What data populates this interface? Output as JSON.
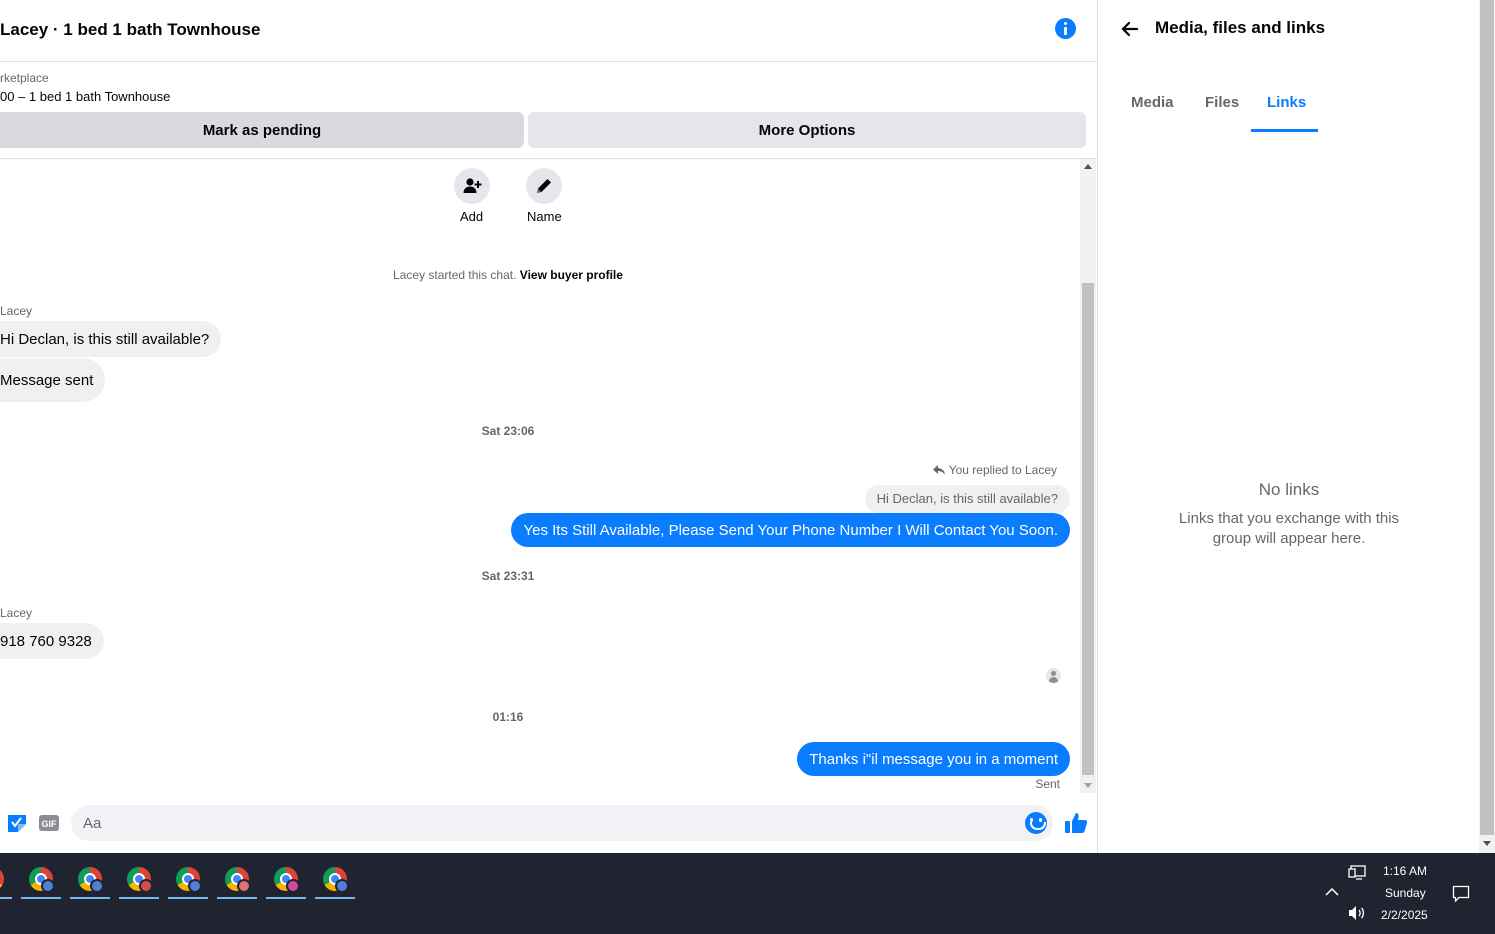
{
  "chat": {
    "title": "Lacey · 1 bed 1 bath Townhouse",
    "marketplace_label": "rketplace",
    "listing": "00 – 1 bed 1 bath Townhouse",
    "mark_pending_label": "Mark as pending",
    "more_options_label": "More Options",
    "actions": [
      {
        "label": "Add",
        "icon": "add-person-icon"
      },
      {
        "label": "Name",
        "icon": "pencil-icon"
      }
    ],
    "system_line": {
      "text": "Lacey started this chat.",
      "link": "View buyer profile"
    },
    "sender_name": "Lacey",
    "messages_in_1": [
      "Hi Declan, is this still available?",
      "Message sent"
    ],
    "timestamp_1": "Sat 23:06",
    "reply_label": "You replied to Lacey",
    "quoted_text": "Hi Declan, is this still available?",
    "reply_text": "Yes Its Still Available, Please Send Your Phone Number I Will Contact You Soon.",
    "timestamp_2": "Sat 23:31",
    "sender_name_2": "Lacey",
    "message_in_phone": "918 760 9328",
    "timestamp_3": "01:16",
    "last_message": "Thanks i\"il message you in a moment",
    "status": "Sent",
    "composer_placeholder": "Aa",
    "composer_value": ""
  },
  "panel": {
    "title": "Media, files and links",
    "tabs": [
      {
        "label": "Media",
        "active": false
      },
      {
        "label": "Files",
        "active": false
      },
      {
        "label": "Links",
        "active": true
      }
    ],
    "empty_title": "No links",
    "empty_text": "Links that you exchange with this group will appear here."
  },
  "taskbar": {
    "time": "1:16 AM",
    "day": "Sunday",
    "date": "2/2/2025",
    "app_badges": [
      "#4f7fd6",
      "#4f7fd6",
      "#d34c4c",
      "#4f7fd6",
      "#e0707a",
      "#c94c9c",
      "#4f7fd6"
    ]
  },
  "colors": {
    "accent": "#0a7cff",
    "bubble_in": "#f0f0f0",
    "taskbar": "#1f2430"
  }
}
